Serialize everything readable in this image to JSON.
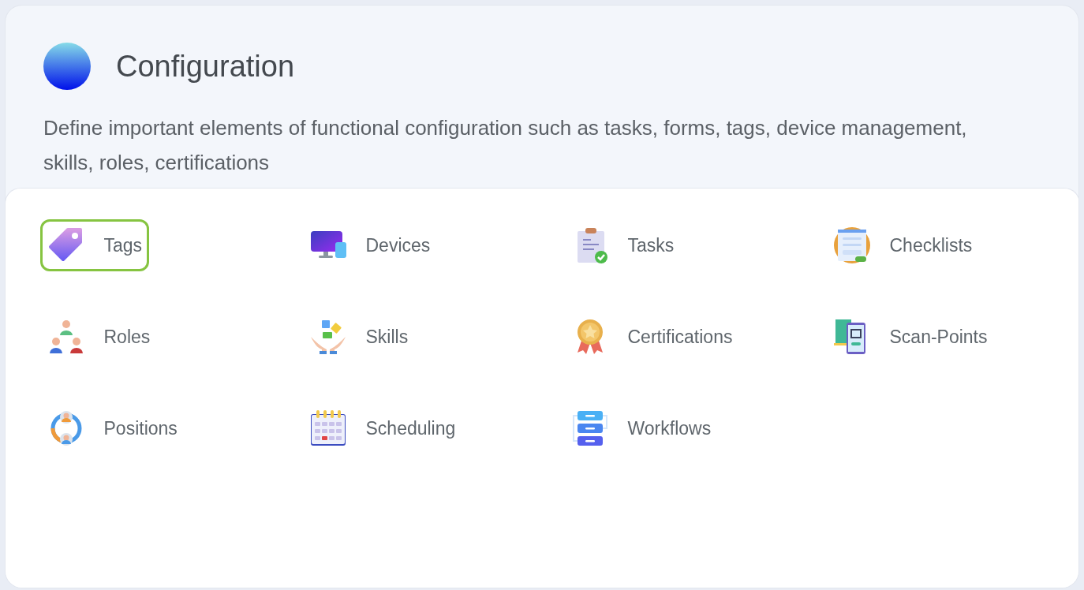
{
  "header": {
    "title": "Configuration",
    "description": "Define important elements of functional configuration such as tasks, forms, tags, device management, skills, roles, certifications"
  },
  "items": [
    {
      "label": "Tags",
      "kind": "tag",
      "selected": true
    },
    {
      "label": "Devices",
      "kind": "devices",
      "selected": false
    },
    {
      "label": "Tasks",
      "kind": "clipboard",
      "selected": false
    },
    {
      "label": "Checklists",
      "kind": "form",
      "selected": false
    },
    {
      "label": "Roles",
      "kind": "people",
      "selected": false
    },
    {
      "label": "Skills",
      "kind": "puzzle",
      "selected": false
    },
    {
      "label": "Certifications",
      "kind": "medal",
      "selected": false
    },
    {
      "label": "Scan-Points",
      "kind": "qr",
      "selected": false
    },
    {
      "label": "Positions",
      "kind": "rotation",
      "selected": false
    },
    {
      "label": "Scheduling",
      "kind": "calendar",
      "selected": false
    },
    {
      "label": "Workflows",
      "kind": "stack",
      "selected": false
    }
  ]
}
